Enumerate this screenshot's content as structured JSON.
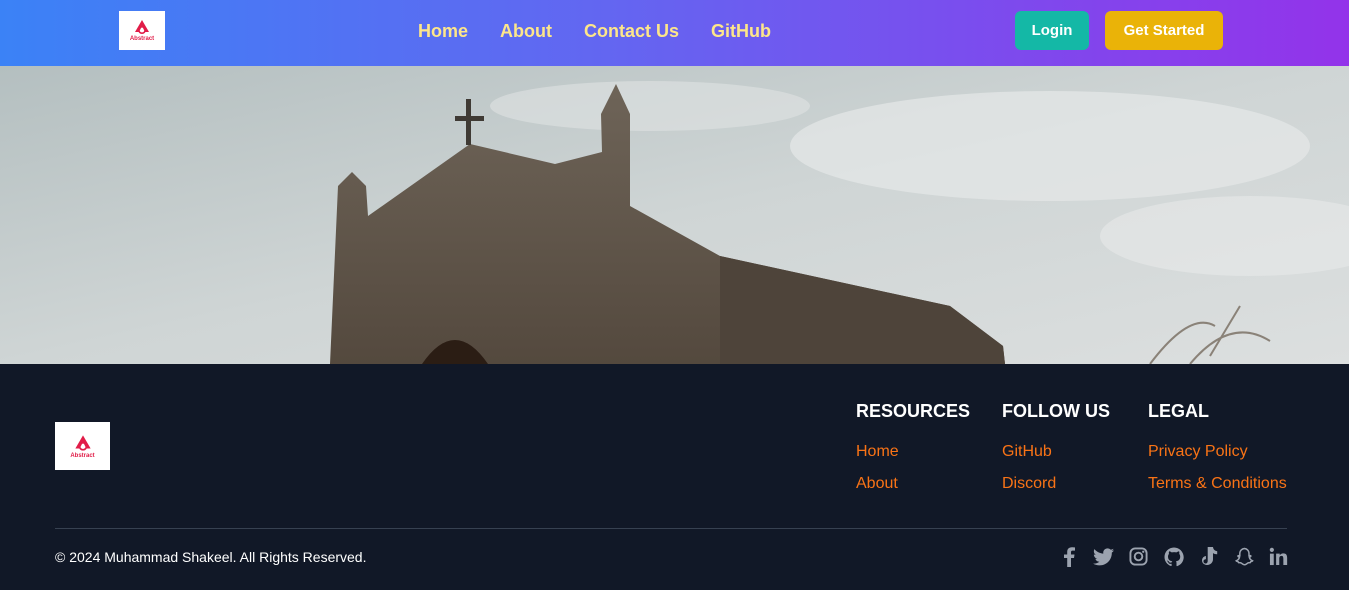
{
  "navbar": {
    "logo_text": "Abstract",
    "links": [
      "Home",
      "About",
      "Contact Us",
      "GitHub"
    ],
    "login_label": "Login",
    "get_started_label": "Get Started"
  },
  "footer": {
    "logo_text": "Abstract",
    "columns": [
      {
        "title": "RESOURCES",
        "links": [
          "Home",
          "About"
        ]
      },
      {
        "title": "FOLLOW US",
        "links": [
          "GitHub",
          "Discord"
        ]
      },
      {
        "title": "LEGAL",
        "links": [
          "Privacy Policy",
          "Terms & Conditions"
        ]
      }
    ],
    "copyright": "© 2024 Muhammad Shakeel. All Rights Reserved.",
    "socials": [
      "facebook-icon",
      "twitter-icon",
      "instagram-icon",
      "github-icon",
      "tiktok-icon",
      "snapchat-icon",
      "linkedin-icon"
    ]
  },
  "colors": {
    "nav_gradient_start": "#3b82f6",
    "nav_gradient_end": "#9333ea",
    "nav_link": "#fde68a",
    "login_bg": "#14b8a6",
    "get_started_bg": "#eab308",
    "footer_bg": "#111827",
    "footer_link": "#f97316"
  }
}
